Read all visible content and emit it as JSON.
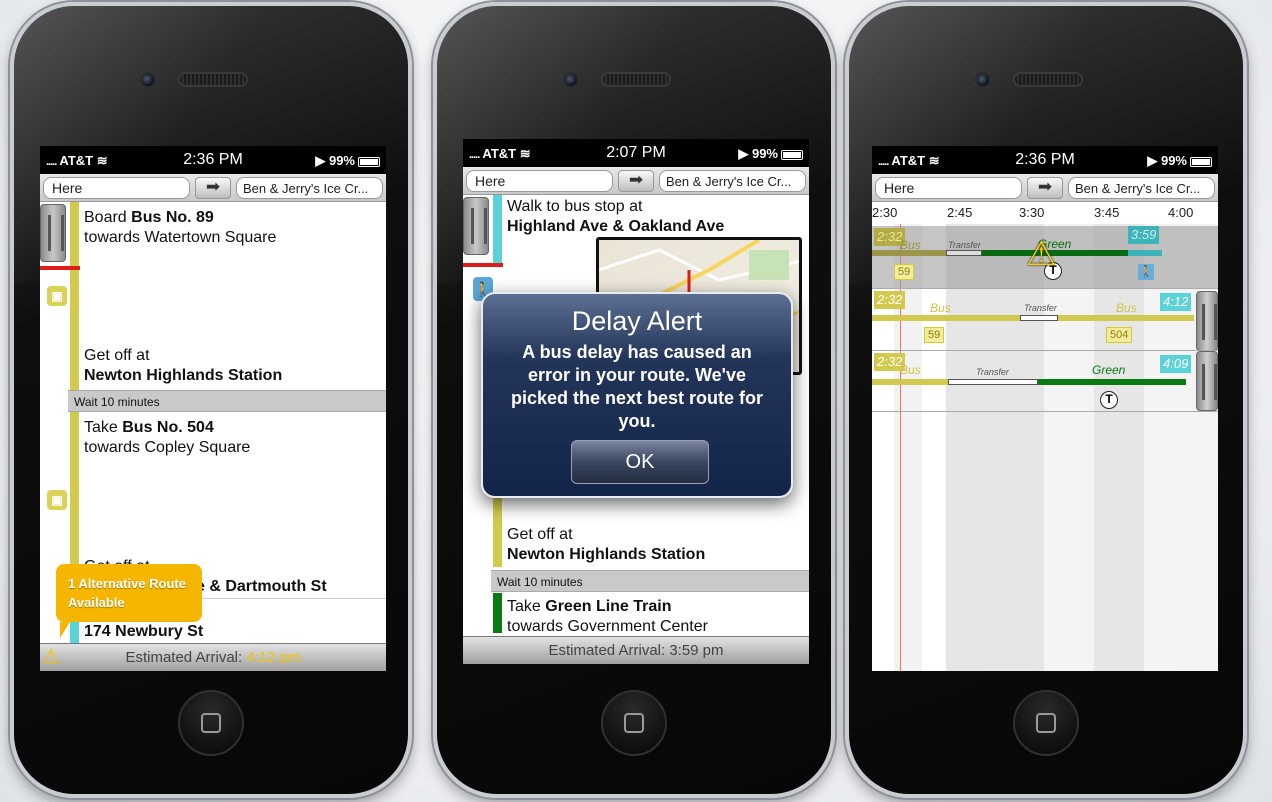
{
  "status": {
    "carrier": "AT&T",
    "battery": "99%"
  },
  "phones": [
    {
      "time": "2:36 PM",
      "search": {
        "from": "Here",
        "to": "Ben & Jerry's Ice Cr..."
      },
      "steps": {
        "s1_pre": "Board ",
        "s1_bold": "Bus No. 89",
        "s1_sub": "towards Watertown Square",
        "s2_pre": "Get off at",
        "s2_bold": "Newton Highlands Station",
        "wait": "Wait 10 minutes",
        "s3_pre": "Take ",
        "s3_bold": "Bus No. 504",
        "s3_sub": "towards Copley Square",
        "s4_pre": "Get off at",
        "s4_bold": "e & Dartmouth St",
        "s5_bold": "174 Newbury St"
      },
      "tooltip": "1 Alternative Route Available",
      "arrival_label": "Estimated Arrival: ",
      "arrival_time": "4:12 pm"
    },
    {
      "time": "2:07 PM",
      "search": {
        "from": "Here",
        "to": "Ben & Jerry's Ice Cr..."
      },
      "steps": {
        "s1_pre": "Walk to bus stop at",
        "s1_bold": "Highland Ave & Oakland Ave",
        "s2_pre": "Get off at",
        "s2_bold": "Newton Highlands Station",
        "wait": "Wait 10 minutes",
        "s3_pre": "Take ",
        "s3_bold": "Green Line Train",
        "s3_sub": "towards Government Center"
      },
      "dialog": {
        "title": "Delay Alert",
        "message": "A bus delay has caused an error in your route. We've picked the next best route for you.",
        "ok": "OK"
      },
      "arrival_label": "Estimated Arrival: 3:59 pm"
    },
    {
      "time": "2:36 PM",
      "search": {
        "from": "Here",
        "to": "Ben & Jerry's Ice Cr..."
      },
      "axis": [
        "2:30",
        "2:45",
        "3:30",
        "3:45",
        "4:00"
      ],
      "routes": [
        {
          "start": "2:32",
          "end": "3:59",
          "seg1": "Bus",
          "seg2": "Transfer",
          "seg3": "Green",
          "bus_no": "59"
        },
        {
          "start": "2:32",
          "end": "4:12",
          "seg1": "Bus",
          "seg2": "Transfer",
          "seg3": "Bus",
          "bus_no": "59",
          "bus_no2": "504"
        },
        {
          "start": "2:32",
          "end": "4:09",
          "seg1": "Bus",
          "seg2": "Transfer",
          "seg3": "Green",
          "t_symbol": "T"
        }
      ]
    }
  ],
  "colors": {
    "bus": "#d2c94f",
    "green_line": "#0a7a12",
    "walk": "#5ad3d8",
    "alert": "#f6b600",
    "dialog": "#1b2d52"
  }
}
